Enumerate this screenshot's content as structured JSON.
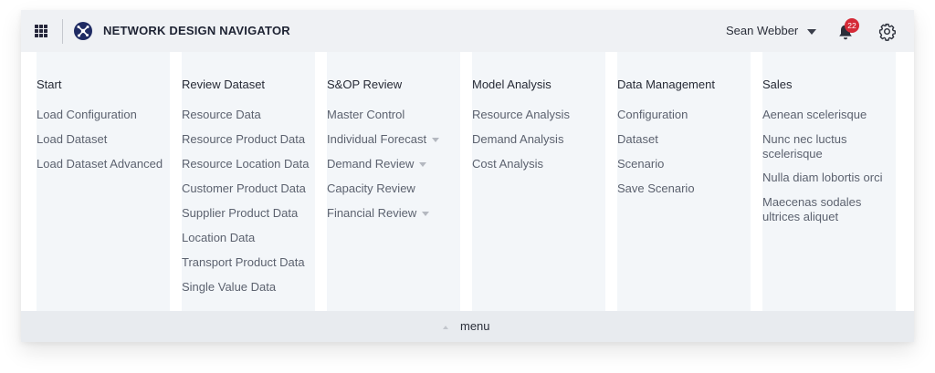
{
  "header": {
    "app_title": "NETWORK DESIGN NAVIGATOR",
    "user_name": "Sean Webber",
    "notification_count": "22",
    "icons": {
      "apps": "grid-icon",
      "logo": "network-logo-icon",
      "notifications": "bell-icon",
      "settings": "gear-icon"
    }
  },
  "columns": [
    {
      "title": "Start",
      "items": [
        {
          "label": "Load Configuration"
        },
        {
          "label": "Load Dataset"
        },
        {
          "label": "Load Dataset Advanced"
        }
      ]
    },
    {
      "title": "Review Dataset",
      "items": [
        {
          "label": "Resource Data"
        },
        {
          "label": "Resource Product Data"
        },
        {
          "label": "Resource Location Data"
        },
        {
          "label": "Customer Product Data"
        },
        {
          "label": "Supplier Product Data"
        },
        {
          "label": "Location Data"
        },
        {
          "label": "Transport Product Data"
        },
        {
          "label": "Single Value Data"
        }
      ]
    },
    {
      "title": "S&OP Review",
      "items": [
        {
          "label": "Master Control"
        },
        {
          "label": "Individual Forecast",
          "has_submenu": true
        },
        {
          "label": "Demand Review",
          "has_submenu": true
        },
        {
          "label": "Capacity Review"
        },
        {
          "label": "Financial Review",
          "has_submenu": true
        }
      ]
    },
    {
      "title": "Model Analysis",
      "items": [
        {
          "label": "Resource Analysis"
        },
        {
          "label": "Demand Analysis"
        },
        {
          "label": "Cost Analysis"
        }
      ]
    },
    {
      "title": "Data Management",
      "items": [
        {
          "label": "Configuration"
        },
        {
          "label": "Dataset"
        },
        {
          "label": "Scenario"
        },
        {
          "label": "Save Scenario"
        }
      ]
    },
    {
      "title": "Sales",
      "items": [
        {
          "label": "Aenean scelerisque"
        },
        {
          "label": "Nunc nec luctus scelerisque"
        },
        {
          "label": "Nulla diam lobortis orci"
        },
        {
          "label": "Maecenas sodales ultrices aliquet"
        }
      ]
    }
  ],
  "footer": {
    "toggle_label": "menu"
  },
  "colors": {
    "header_bg": "#eff1f4",
    "column_bg": "#f3f6f9",
    "footer_bg": "#e8ebef",
    "logo_bg": "#1f2b63",
    "badge_bg": "#d52a37",
    "title_text": "#1e2333",
    "item_text": "#5c626f"
  }
}
